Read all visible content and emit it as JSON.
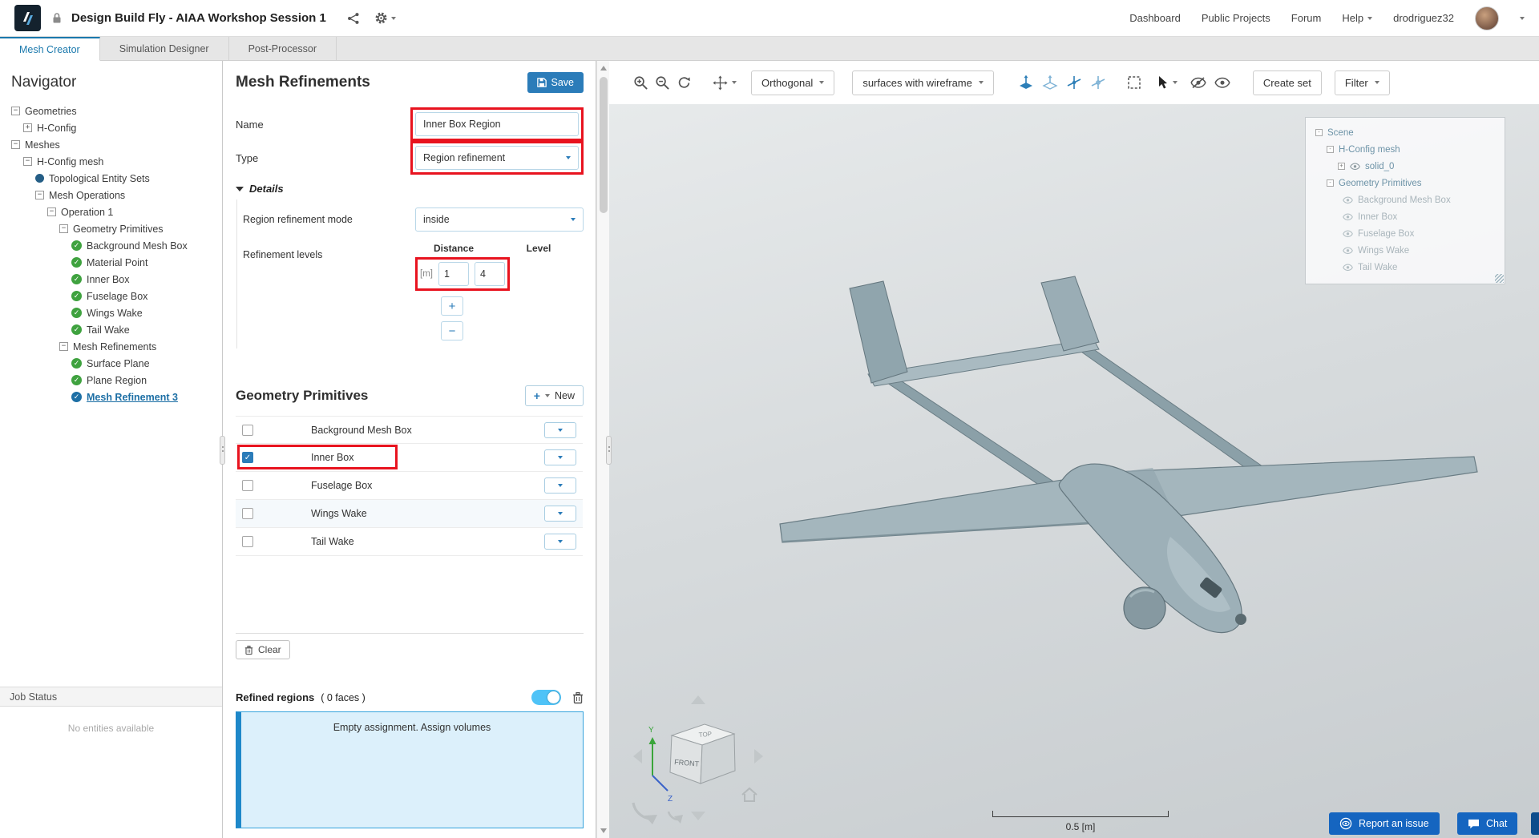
{
  "colors": {
    "accent_blue": "#2b7cb9",
    "highlight_red": "#e8131f",
    "check_green": "#3fa23f",
    "toggle_on": "#4fc3f7",
    "button_blue": "#1565c0"
  },
  "header": {
    "project_title": "Design Build Fly - AIAA Workshop Session 1",
    "nav": [
      "Dashboard",
      "Public Projects",
      "Forum",
      "Help"
    ],
    "username": "drodriguez32"
  },
  "tabs": [
    {
      "label": "Mesh Creator",
      "active": true
    },
    {
      "label": "Simulation Designer",
      "active": false
    },
    {
      "label": "Post-Processor",
      "active": false
    }
  ],
  "navigator": {
    "title": "Navigator",
    "tree": [
      {
        "label": "Geometries"
      },
      {
        "label": "H-Config"
      },
      {
        "label": "Meshes"
      },
      {
        "label": "H-Config mesh"
      },
      {
        "label": "Topological Entity Sets"
      },
      {
        "label": "Mesh Operations"
      },
      {
        "label": "Operation 1"
      },
      {
        "label": "Geometry Primitives"
      },
      {
        "label": "Background Mesh Box"
      },
      {
        "label": "Material Point"
      },
      {
        "label": "Inner Box"
      },
      {
        "label": "Fuselage Box"
      },
      {
        "label": "Wings Wake"
      },
      {
        "label": "Tail Wake"
      },
      {
        "label": "Mesh Refinements"
      },
      {
        "label": "Surface Plane"
      },
      {
        "label": "Plane Region"
      },
      {
        "label": "Mesh Refinement 3",
        "selected": true
      }
    ],
    "job_status_title": "Job Status",
    "job_status_empty": "No entities available"
  },
  "panel": {
    "title": "Mesh Refinements",
    "save_label": "Save",
    "name_label": "Name",
    "name_value": "Inner Box Region",
    "type_label": "Type",
    "type_value": "Region refinement",
    "details_title": "Details",
    "mode_label": "Region refinement mode",
    "mode_value": "inside",
    "levels_label": "Refinement levels",
    "distance_header": "Distance",
    "level_header": "Level",
    "unit": "[m]",
    "distance_value": "1",
    "level_value": "4",
    "add_label": "+",
    "remove_label": "−",
    "primitives_title": "Geometry Primitives",
    "new_label": "New",
    "primitive_rows": [
      {
        "label": "Background Mesh Box",
        "checked": false
      },
      {
        "label": "Inner Box",
        "checked": true
      },
      {
        "label": "Fuselage Box",
        "checked": false
      },
      {
        "label": "Wings Wake",
        "checked": false
      },
      {
        "label": "Tail Wake",
        "checked": false
      }
    ],
    "clear_label": "Clear",
    "refined_label": "Refined regions",
    "refined_count": "( 0 faces )",
    "refined_toggle_on": true,
    "empty_message": "Empty assignment. Assign volumes"
  },
  "viewport": {
    "projection": "Orthogonal",
    "render_mode": "surfaces with wireframe",
    "create_set_label": "Create set",
    "filter_label": "Filter",
    "scene_tree": [
      {
        "label": "Scene"
      },
      {
        "label": "H-Config mesh"
      },
      {
        "label": "solid_0"
      },
      {
        "label": "Geometry Primitives"
      },
      {
        "label": "Background Mesh Box"
      },
      {
        "label": "Inner Box"
      },
      {
        "label": "Fuselage Box"
      },
      {
        "label": "Wings Wake"
      },
      {
        "label": "Tail Wake"
      }
    ],
    "cube_front": "FRONT",
    "cube_top": "TOP",
    "axis_y": "Y",
    "axis_z": "Z",
    "scale_label": "0.5 [m]",
    "report_label": "Report an issue",
    "chat_label": "Chat"
  }
}
